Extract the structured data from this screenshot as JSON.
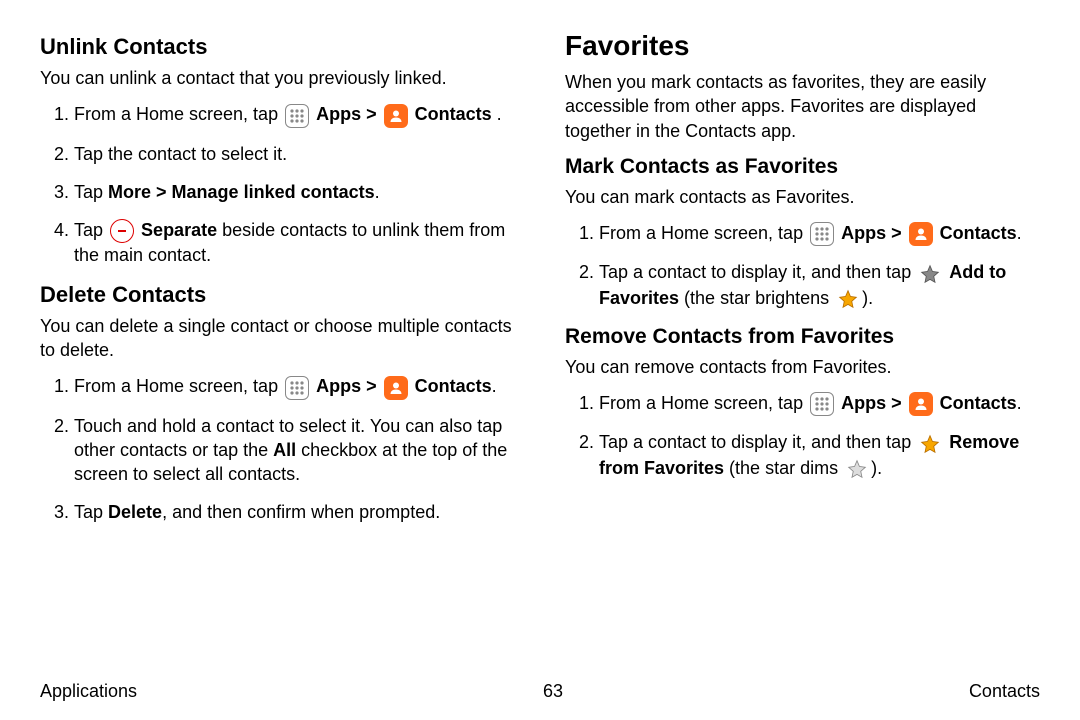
{
  "left": {
    "h_unlink": "Unlink Contacts",
    "p_unlink": "You can unlink a contact that you previously linked.",
    "ol_unlink": {
      "i1_pre": "From a Home screen, tap ",
      "i1_apps": "Apps",
      "i1_contacts": "Contacts",
      "i1_post": " .",
      "i2": "Tap the contact to select it.",
      "i3_pre": "Tap ",
      "i3_bold": "More > Manage linked contacts",
      "i3_post": ".",
      "i4_pre": "Tap ",
      "i4_bold": "Separate",
      "i4_post": "  beside contacts to unlink them from the main contact."
    },
    "h_delete": "Delete Contacts",
    "p_delete": "You can delete a single contact or choose multiple contacts to delete.",
    "ol_delete": {
      "i1_pre": "From a Home screen, tap ",
      "i1_apps": "Apps",
      "i1_contacts": "Contacts",
      "i1_post": ".",
      "i2_pre": "Touch and hold a contact to select it. You can also tap other contacts or tap the ",
      "i2_bold": "All",
      "i2_post": " checkbox at the top of the screen to select all contacts.",
      "i3_pre": "Tap ",
      "i3_bold": "Delete",
      "i3_post": ", and then confirm when prompted."
    }
  },
  "right": {
    "h_fav": "Favorites",
    "p_fav": "When you mark contacts as favorites, they are easily accessible from other apps. Favorites are displayed together in the Contacts app.",
    "h_mark": "Mark Contacts as Favorites",
    "p_mark": "You can mark contacts as Favorites.",
    "ol_mark": {
      "i1_pre": "From a Home screen, tap ",
      "i1_apps": "Apps",
      "i1_contacts": "Contacts",
      "i1_post": ".",
      "i2_pre": "Tap a contact to display it, and then tap ",
      "i2_bold": "Add to Favorites",
      "i2_mid": " (the star brightens ",
      "i2_post": ")."
    },
    "h_remove": "Remove Contacts from Favorites",
    "p_remove": "You can remove contacts from Favorites.",
    "ol_remove": {
      "i1_pre": "From a Home screen, tap ",
      "i1_apps": "Apps",
      "i1_contacts": "Contacts",
      "i1_post": ".",
      "i2_pre": "Tap a contact to display it, and then tap ",
      "i2_bold": "Remove from Favorites",
      "i2_mid": " (the star dims ",
      "i2_post": ")."
    }
  },
  "footer": {
    "left": "Applications",
    "center": "63",
    "right": "Contacts"
  },
  "glyphs": {
    "chevron": ">"
  }
}
